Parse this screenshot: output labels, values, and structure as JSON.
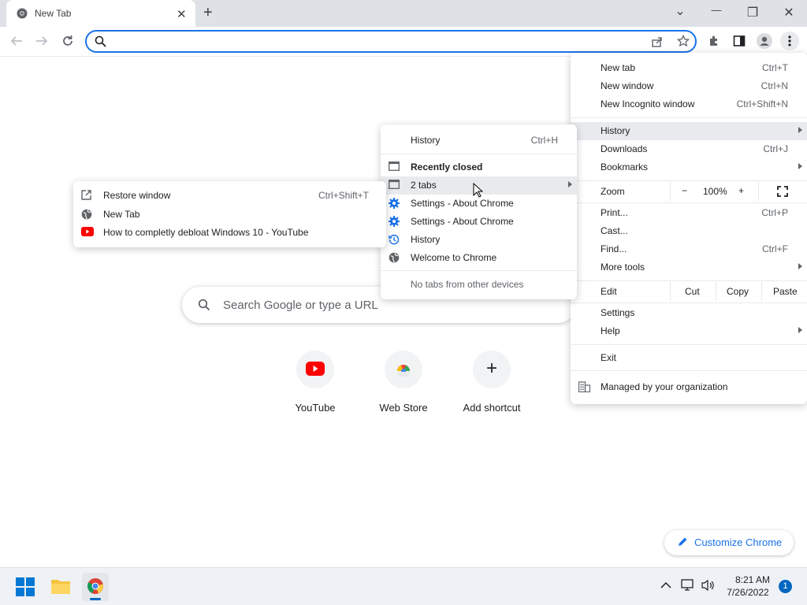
{
  "browser": {
    "tab_title": "New Tab",
    "tab_close": "✕",
    "new_tab": "+",
    "window_buttons": {
      "dropdown": "⌄",
      "minimize": "—",
      "restore": "❐",
      "close": "✕"
    }
  },
  "page": {
    "search_placeholder": "Search Google or type a URL",
    "shortcuts": [
      {
        "label": "YouTube"
      },
      {
        "label": "Web Store"
      },
      {
        "label": "Add shortcut",
        "glyph": "+"
      }
    ],
    "customize_label": "Customize Chrome"
  },
  "main_menu": {
    "new_tab": "New tab",
    "new_tab_sc": "Ctrl+T",
    "new_window": "New window",
    "new_window_sc": "Ctrl+N",
    "incognito": "New Incognito window",
    "incognito_sc": "Ctrl+Shift+N",
    "history": "History",
    "downloads": "Downloads",
    "downloads_sc": "Ctrl+J",
    "bookmarks": "Bookmarks",
    "zoom": "Zoom",
    "zoom_minus": "−",
    "zoom_value": "100%",
    "zoom_plus": "+",
    "print": "Print...",
    "print_sc": "Ctrl+P",
    "cast": "Cast...",
    "find": "Find...",
    "find_sc": "Ctrl+F",
    "more_tools": "More tools",
    "edit": "Edit",
    "cut": "Cut",
    "copy": "Copy",
    "paste": "Paste",
    "settings": "Settings",
    "help": "Help",
    "exit": "Exit",
    "managed": "Managed by your organization"
  },
  "history_menu": {
    "history": "History",
    "history_sc": "Ctrl+H",
    "recently_closed": "Recently closed",
    "two_tabs": "2 tabs",
    "settings_about_1": "Settings - About Chrome",
    "settings_about_2": "Settings - About Chrome",
    "history_item": "History",
    "welcome": "Welcome to Chrome",
    "no_tabs": "No tabs from other devices"
  },
  "tabs_menu": {
    "restore": "Restore window",
    "restore_sc": "Ctrl+Shift+T",
    "new_tab": "New Tab",
    "youtube_video": "How to completly debloat Windows 10 - YouTube"
  },
  "taskbar": {
    "time": "8:21 AM",
    "date": "7/26/2022",
    "notifications": "1"
  },
  "colors": {
    "accent": "#1a73e8",
    "youtube": "#ff0000"
  }
}
